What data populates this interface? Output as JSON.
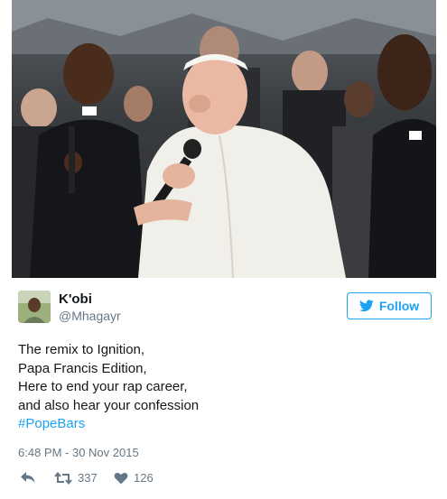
{
  "tweet": {
    "display_name": "K'obi",
    "handle": "@Mhagayr",
    "follow_label": "Follow",
    "text_lines": [
      "The remix to Ignition,",
      "Papa Francis Edition,",
      "Here to end your rap career,",
      "and also hear your confession"
    ],
    "hashtag": "#PopeBars",
    "timestamp": "6:48 PM - 30 Nov 2015",
    "retweet_count": "337",
    "like_count": "126"
  },
  "icons": {
    "follow": "twitter-bird-icon",
    "reply": "reply-arrow-icon",
    "retweet": "retweet-icon",
    "like": "heart-icon"
  },
  "colors": {
    "accent": "#1da1f2",
    "secondary_text": "#657786",
    "primary_text": "#14171a"
  }
}
